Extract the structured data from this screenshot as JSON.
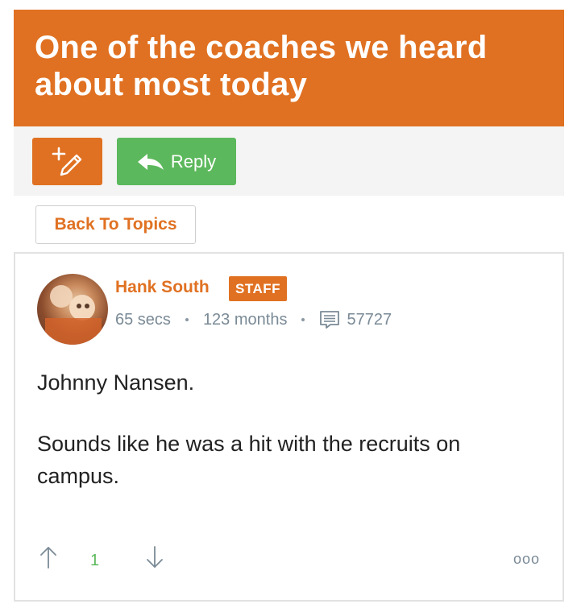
{
  "topic": {
    "title": "One of the coaches we heard about most today"
  },
  "toolbar": {
    "new_icon": "pencil-plus-icon",
    "reply_label": "Reply",
    "reply_icon": "reply-arrow-icon"
  },
  "nav": {
    "back_label": "Back To Topics"
  },
  "post": {
    "author": "Hank South",
    "badge": "STAFF",
    "time_ago": "65 secs",
    "member_for": "123 months",
    "message_count": "57727",
    "paragraphs": [
      "Johnny Nansen.",
      "Sounds like he was a hit with the recruits on campus."
    ],
    "vote_count": "1",
    "more_label": "ooo"
  },
  "colors": {
    "accent": "#e07122",
    "reply_green": "#5cb85c",
    "meta_gray": "#7a8a96"
  }
}
